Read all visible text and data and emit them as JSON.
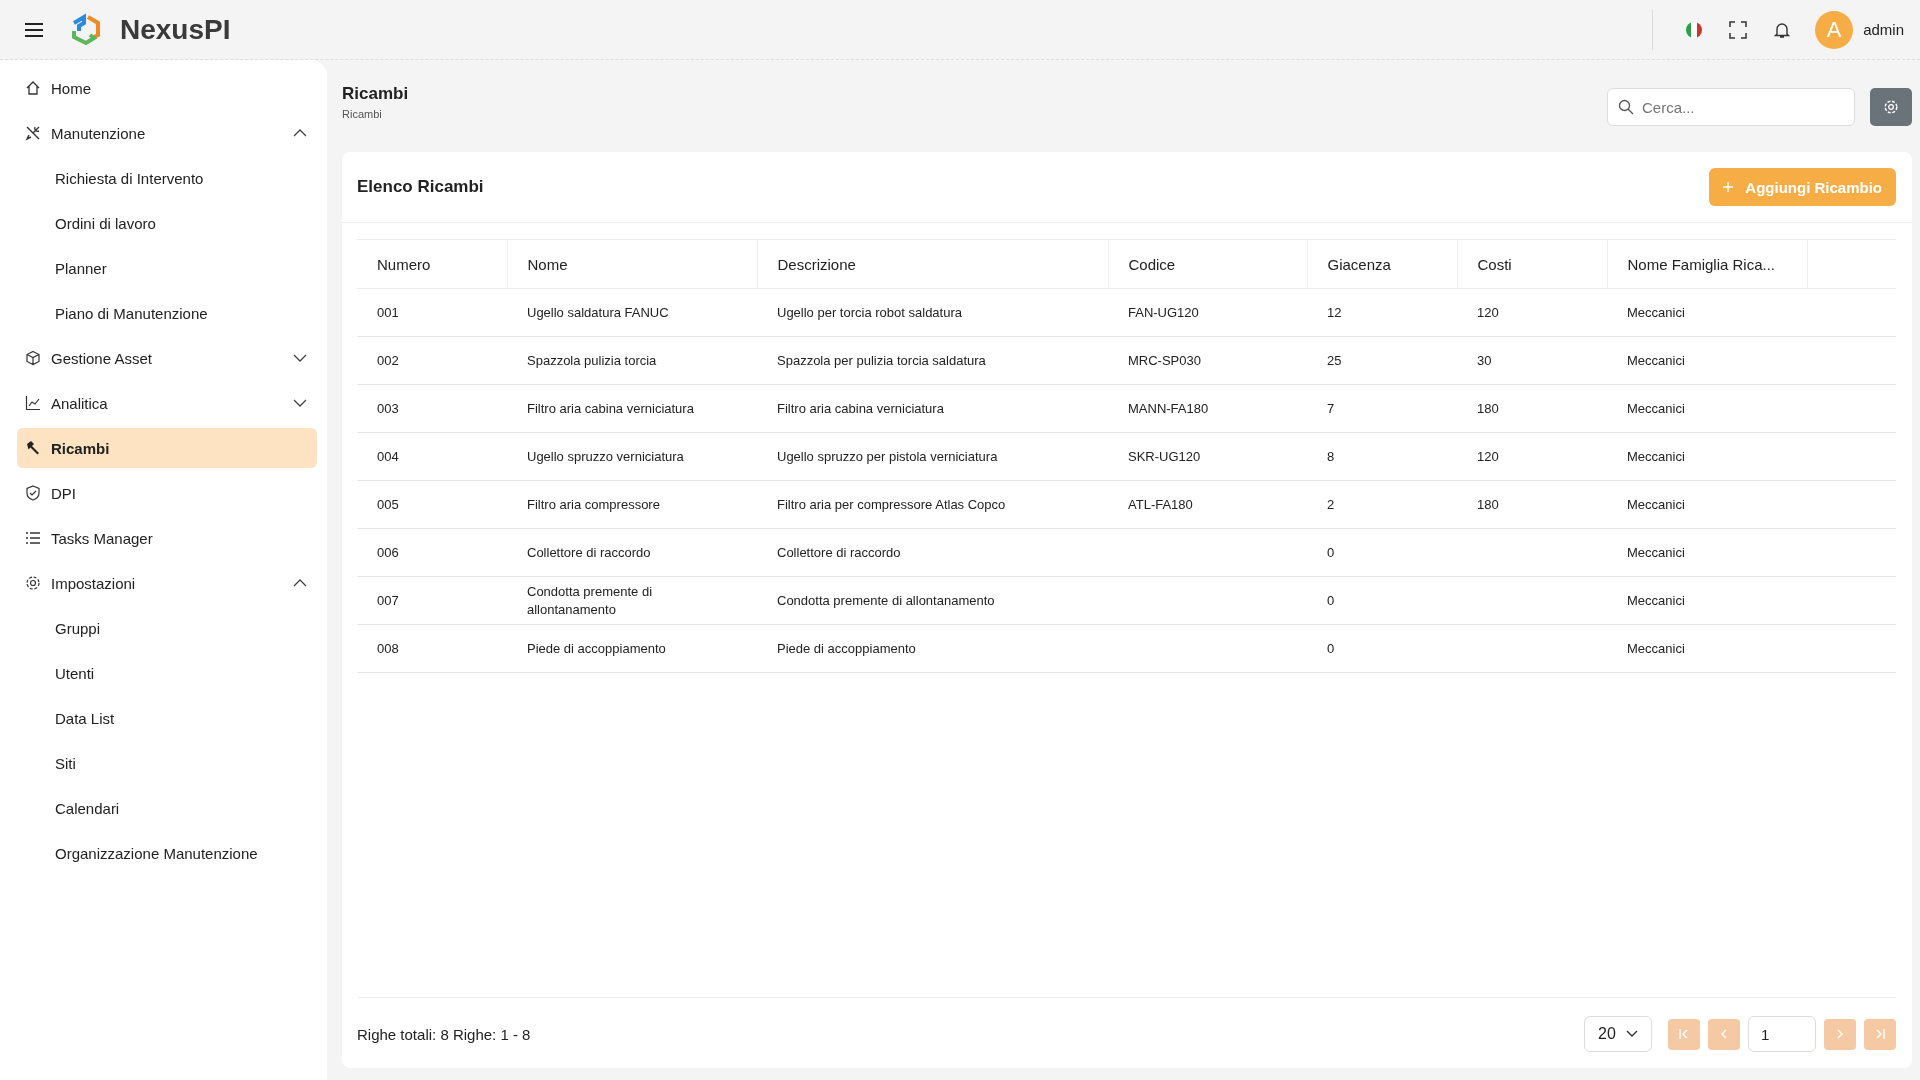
{
  "topbar": {
    "logo": "NexusPI",
    "user": {
      "initial": "A",
      "name": "admin"
    }
  },
  "sidebar": {
    "items": [
      {
        "label": "Home",
        "selected": false
      },
      {
        "label": "Manutenzione",
        "selected": false,
        "expanded": true,
        "children": [
          {
            "label": "Richiesta di Intervento",
            "selected": false
          },
          {
            "label": "Ordini di lavoro",
            "selected": false
          },
          {
            "label": "Planner",
            "selected": false
          },
          {
            "label": "Piano di Manutenzione",
            "selected": false
          }
        ]
      },
      {
        "label": "Gestione Asset",
        "selected": false,
        "expanded": false
      },
      {
        "label": "Analitica",
        "selected": false,
        "expanded": false
      },
      {
        "label": "Ricambi",
        "selected": true
      },
      {
        "label": "DPI",
        "selected": false
      },
      {
        "label": "Tasks Manager",
        "selected": false
      },
      {
        "label": "Impostazioni",
        "selected": false,
        "expanded": true,
        "children": [
          {
            "label": "Gruppi",
            "selected": false
          },
          {
            "label": "Utenti",
            "selected": false
          },
          {
            "label": "Data List",
            "selected": false
          },
          {
            "label": "Siti",
            "selected": false
          },
          {
            "label": "Calendari",
            "selected": false
          },
          {
            "label": "Organizzazione Manutenzione",
            "selected": false
          }
        ]
      }
    ]
  },
  "page": {
    "title": "Ricambi",
    "breadcrumb": "Ricambi",
    "search": {
      "placeholder": "Cerca..."
    }
  },
  "card": {
    "title": "Elenco Ricambi",
    "add_button": "Aggiungi Ricambio"
  },
  "table": {
    "columns": [
      "Numero",
      "Nome",
      "Descrizione",
      "Codice",
      "Giacenza",
      "Costi",
      "Nome Famiglia Rica..."
    ],
    "rows": [
      [
        "001",
        "Ugello saldatura FANUC",
        "Ugello per torcia robot saldatura",
        "FAN-UG120",
        "12",
        "120",
        "Meccanici"
      ],
      [
        "002",
        "Spazzola pulizia torcia",
        "Spazzola per pulizia torcia saldatura",
        "MRC-SP030",
        "25",
        "30",
        "Meccanici"
      ],
      [
        "003",
        "Filtro aria cabina verniciatura",
        "Filtro aria cabina verniciatura",
        "MANN-FA180",
        "7",
        "180",
        "Meccanici"
      ],
      [
        "004",
        "Ugello spruzzo verniciatura",
        "Ugello spruzzo per pistola verniciatura",
        "SKR-UG120",
        "8",
        "120",
        "Meccanici"
      ],
      [
        "005",
        "Filtro aria compressore",
        "Filtro aria per compressore Atlas Copco",
        "ATL-FA180",
        "2",
        "180",
        "Meccanici"
      ],
      [
        "006",
        "Collettore di raccordo",
        "Collettore di raccordo",
        "",
        "0",
        "",
        "Meccanici"
      ],
      [
        "007",
        "Condotta premente di allontanamento",
        "Condotta premente di allontanamento",
        "",
        "0",
        "",
        "Meccanici"
      ],
      [
        "008",
        "Piede di accoppiamento",
        "Piede di accoppiamento",
        "",
        "0",
        "",
        "Meccanici"
      ]
    ]
  },
  "footer": {
    "summary": "Righe totali: 8 Righe: 1 - 8",
    "page_size": "20",
    "page": "1",
    "pager": [
      {
        "kind": "first",
        "disabled": true
      },
      {
        "kind": "prev",
        "disabled": true
      },
      {
        "kind": "next",
        "disabled": true
      },
      {
        "kind": "last",
        "disabled": true
      }
    ]
  }
}
